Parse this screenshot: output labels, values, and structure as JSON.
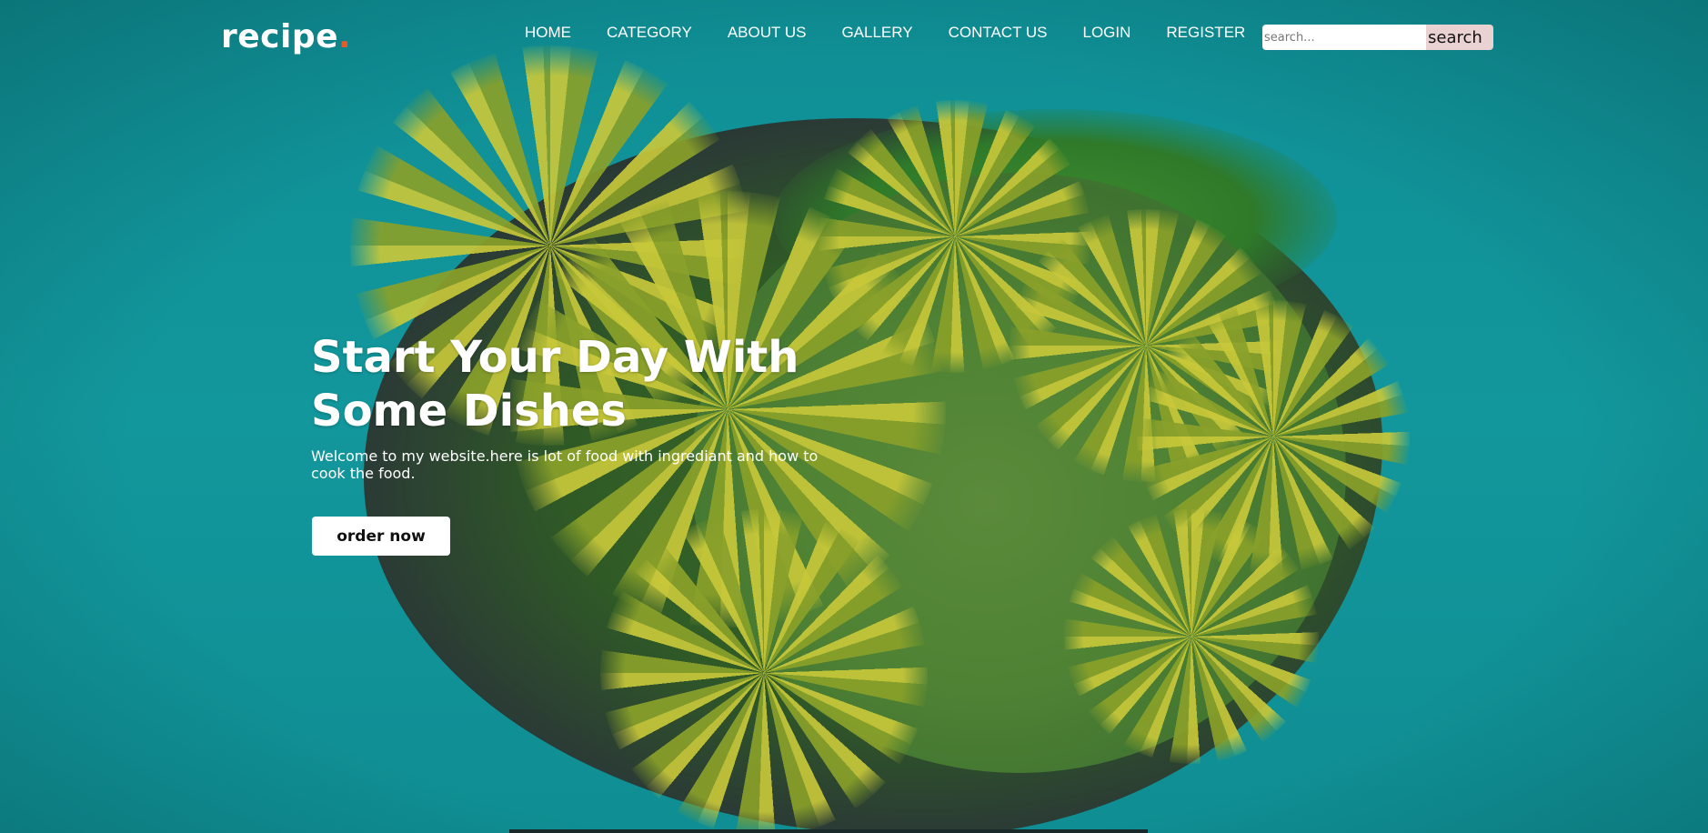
{
  "brand": {
    "name": "recipe",
    "dot": ".",
    "dot_color": "#e85a2a"
  },
  "nav": {
    "items": [
      {
        "label": "HOME"
      },
      {
        "label": "CATEGORY"
      },
      {
        "label": "ABOUT US"
      },
      {
        "label": "GALLERY"
      },
      {
        "label": "CONTACT US"
      },
      {
        "label": "LOGIN"
      },
      {
        "label": "REGISTER"
      }
    ]
  },
  "search": {
    "placeholder": "search...",
    "value": "",
    "button_label": "search"
  },
  "hero": {
    "headline": "Start Your Day With Some Dishes",
    "subtext": "Welcome to my website.here is lot of food with ingrediant and how to cook the food.",
    "cta_label": "order now",
    "background": "aerial-island-palm-trees-image"
  },
  "colors": {
    "ocean": "#12979c",
    "text": "#ffffff",
    "search_button": "#ead2d2",
    "accent": "#e85a2a"
  }
}
